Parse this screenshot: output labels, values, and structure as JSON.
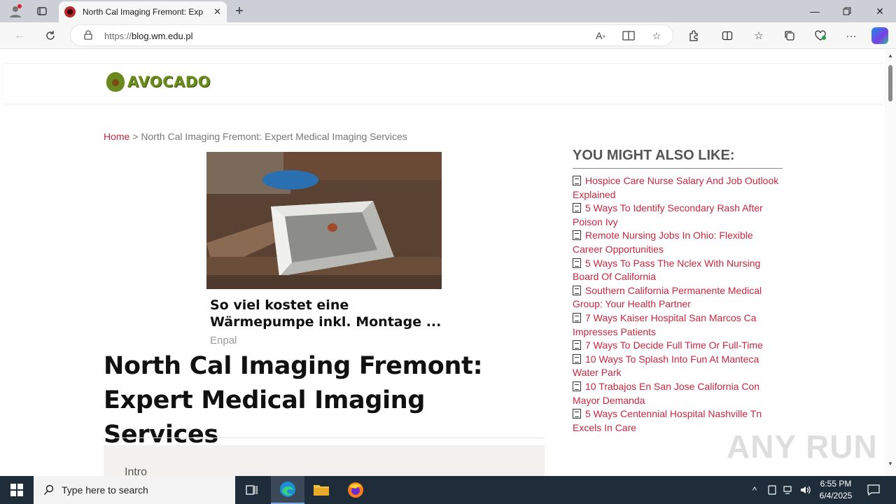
{
  "browser": {
    "tab_title": "North Cal Imaging Fremont: Exp",
    "url_protocol": "https://",
    "url_host": "blog.wm.edu.pl"
  },
  "site": {
    "logo_text": "AVOCADO"
  },
  "breadcrumb": {
    "home": "Home",
    "separator": ">",
    "current": "North Cal Imaging Fremont: Expert Medical Imaging Services"
  },
  "ad": {
    "title": "So viel kostet eine Wärmepumpe inkl. Montage ...",
    "source": "Enpal"
  },
  "post": {
    "title": "North Cal Imaging Fremont: Expert Medical Imaging Services",
    "toc_first": "Intro"
  },
  "sidebar": {
    "heading": "YOU MIGHT ALSO LIKE:",
    "items": [
      "Hospice Care Nurse Salary And Job Outlook Explained",
      "5 Ways To Identify Secondary Rash After Poison Ivy",
      "Remote Nursing Jobs In Ohio: Flexible Career Opportunities",
      "5 Ways To Pass The Nclex With Nursing Board Of California",
      "Southern California Permanente Medical Group: Your Health Partner",
      "7 Ways Kaiser Hospital San Marcos Ca Impresses Patients",
      "7 Ways To Decide Full Time Or Full-Time",
      "10 Ways To Splash Into Fun At Manteca Water Park",
      "10 Trabajos En San Jose California Con Mayor Demanda",
      "5 Ways Centennial Hospital Nashville Tn Excels In Care"
    ]
  },
  "watermark": "ANY RUN",
  "taskbar": {
    "search_placeholder": "Type here to search",
    "time": "6:55 PM",
    "date": "6/4/2025"
  },
  "colors": {
    "link": "#c8273f",
    "logo_green": "#6b8e1a",
    "taskbar": "#1f2c3a"
  }
}
